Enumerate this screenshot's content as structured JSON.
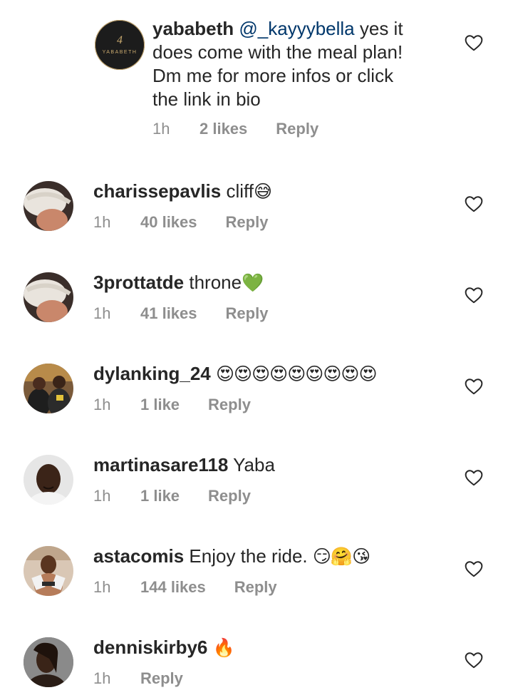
{
  "comments": [
    {
      "username": "yababeth",
      "mention": "@_kayyybella",
      "text_lines": [
        "yes it",
        "does come with the meal plan!",
        "Dm me for more infos or click",
        "the link in bio"
      ],
      "time": "1h",
      "likes": "2 likes",
      "reply": "Reply",
      "avatar": {
        "type": "logo",
        "logo_text": "YABABETH",
        "mark": "4"
      }
    },
    {
      "username": "charissepavlis",
      "text": "cliff",
      "emoji": "😅",
      "time": "1h",
      "likes": "40 likes",
      "reply": "Reply"
    },
    {
      "username": "3prottatde",
      "text": "throne",
      "emoji": "💚",
      "time": "1h",
      "likes": "41 likes",
      "reply": "Reply"
    },
    {
      "username": "dylanking_24",
      "text": "",
      "emoji": "😍😍😍😍😍😍😍😍😍",
      "time": "1h",
      "likes": "1 like",
      "reply": "Reply"
    },
    {
      "username": "martinasare118",
      "text": "Yaba",
      "emoji": "",
      "time": "1h",
      "likes": "1 like",
      "reply": "Reply"
    },
    {
      "username": "astacomis",
      "text": "Enjoy the ride.",
      "emoji": "😏🤗😘",
      "time": "1h",
      "likes": "144 likes",
      "reply": "Reply"
    },
    {
      "username": "denniskirby6",
      "text": "",
      "emoji": "🔥",
      "time": "1h",
      "likes": "",
      "reply": "Reply"
    }
  ],
  "icons": {
    "like": "heart-outline-icon"
  },
  "colors": {
    "text": "#262626",
    "secondary": "#8e8e8e",
    "mention": "#00376b"
  }
}
